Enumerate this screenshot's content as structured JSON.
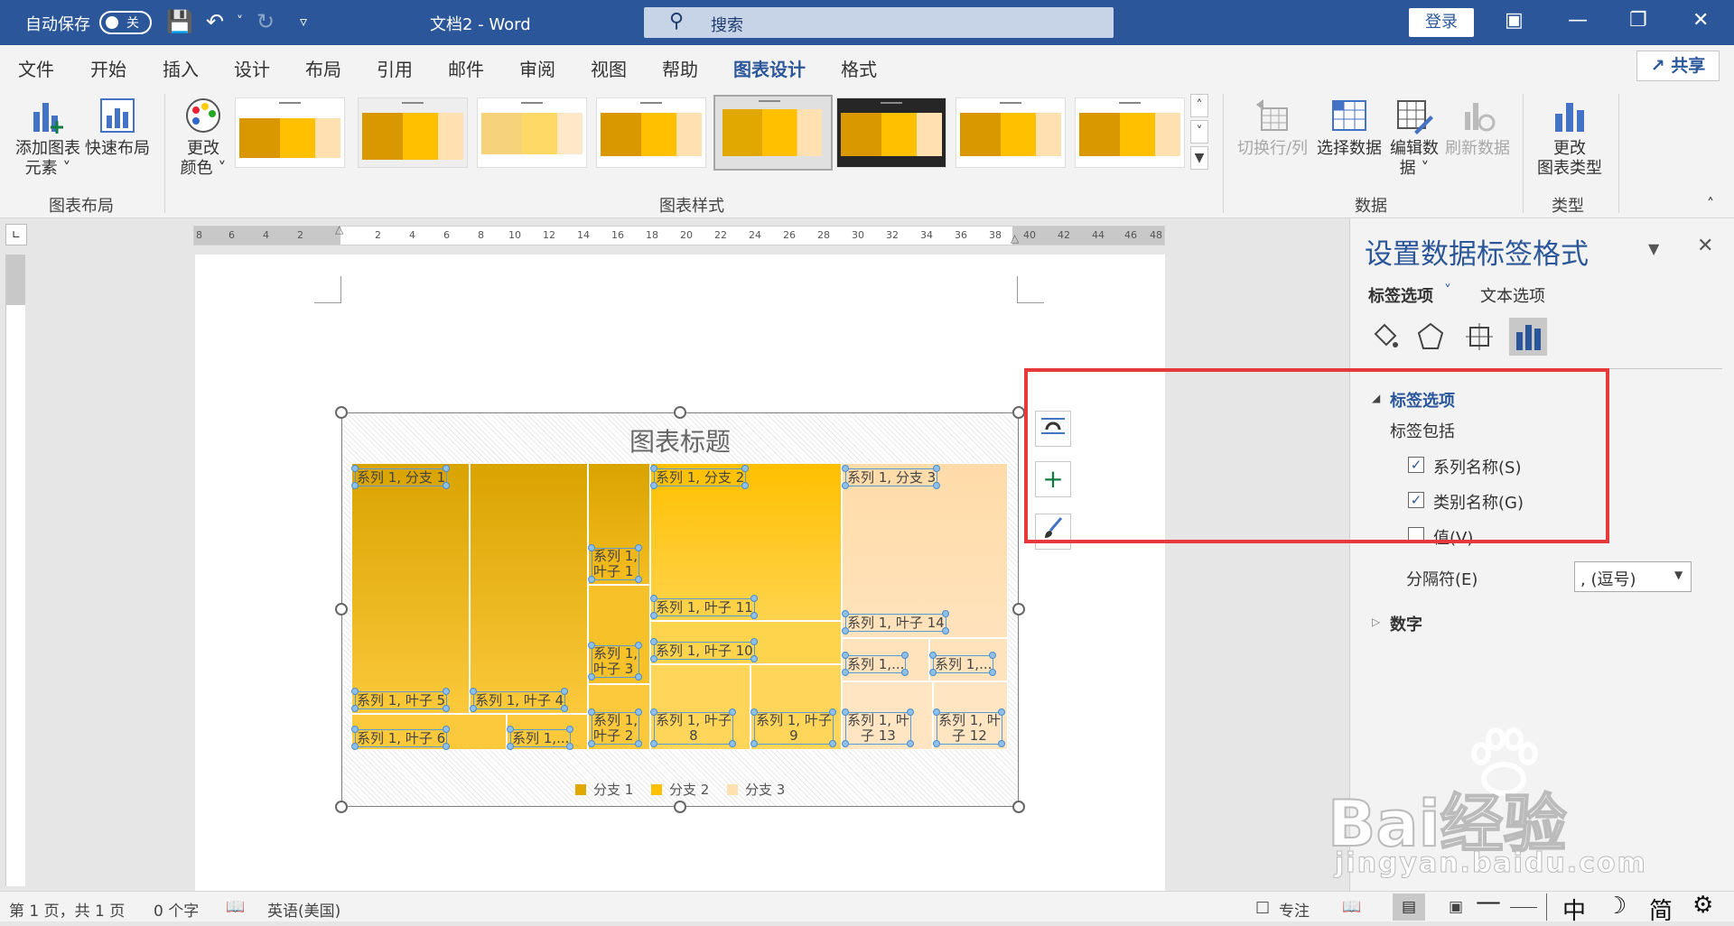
{
  "titlebar": {
    "autosave_label": "自动保存",
    "autosave_state": "关",
    "document_title": "文档2  -  Word",
    "search_placeholder": "搜索",
    "login_label": "登录"
  },
  "menu_tabs": [
    "文件",
    "开始",
    "插入",
    "设计",
    "布局",
    "引用",
    "邮件",
    "审阅",
    "视图",
    "帮助",
    "图表设计",
    "格式"
  ],
  "active_tab": "图表设计",
  "share_label": "共享",
  "ribbon": {
    "add_element": [
      "添加图表",
      "元素 ˅"
    ],
    "quick_layout": "快速布局",
    "change_colors": [
      "更改",
      "颜色 ˅"
    ],
    "group_layout": "图表布局",
    "group_styles": "图表样式",
    "switch_row_col": "切换行/列",
    "select_data": "选择数据",
    "edit_data": [
      "编辑数",
      "据 ˅"
    ],
    "refresh_data": "刷新数据",
    "group_data": "数据",
    "change_type": [
      "更改",
      "图表类型"
    ],
    "group_type": "类型"
  },
  "ruler_ticks": [
    "8",
    "6",
    "4",
    "2",
    "",
    "2",
    "4",
    "6",
    "8",
    "10",
    "12",
    "14",
    "16",
    "18",
    "20",
    "22",
    "24",
    "26",
    "28",
    "30",
    "32",
    "34",
    "36",
    "38",
    "40",
    "42",
    "44",
    "46",
    "48"
  ],
  "chart": {
    "title": "图表标题",
    "labels": {
      "branch1": "系列 1, 分支 1",
      "branch2": "系列 1, 分支 2",
      "branch3": "系列 1, 分支 3",
      "leaf5": "系列 1, 叶子 5",
      "leaf4": "系列 1, 叶子 4",
      "leaf6": "系列 1, 叶子 6",
      "leafx": "系列 1,...",
      "leaf1a": "系列 1,",
      "leaf1b": "叶子 1",
      "leaf3a": "系列 1,",
      "leaf3b": "叶子 3",
      "leaf2a": "系列 1,",
      "leaf2b": "叶子 2",
      "leaf11": "系列 1, 叶子 11",
      "leaf10": "系列 1, 叶子 10",
      "leaf8a": "系列 1, 叶子",
      "leaf8b": "8",
      "leaf9a": "系列 1, 叶子",
      "leaf9b": "9",
      "leaf14": "系列 1, 叶子 14",
      "leafy": "系列 1,...",
      "leafz": "系列 1,...",
      "leaf13a": "系列 1, 叶",
      "leaf13b": "子 13",
      "leaf12a": "系列 1, 叶",
      "leaf12b": "子 12"
    },
    "legend": [
      "分支 1",
      "分支 2",
      "分支 3"
    ],
    "colors": {
      "branch1": "#e0a800",
      "branch2": "#ffc000",
      "branch3": "#ffe0b0"
    }
  },
  "pane": {
    "title": "设置数据标签格式",
    "tab_label_options": "标签选项",
    "tab_text_options": "文本选项",
    "section_label_options": "标签选项",
    "label_contains": "标签包括",
    "cb_series_name": "系列名称(S)",
    "cb_category_name": "类别名称(G)",
    "cb_value": "值(V)",
    "separator_label": "分隔符(E)",
    "separator_value": ", (逗号)",
    "section_number": "数字"
  },
  "status": {
    "page": "第 1 页，共 1 页",
    "words": "0 个字",
    "language": "英语(美国)",
    "focus": "专注",
    "ime": [
      "中",
      "简"
    ]
  },
  "watermark": {
    "brand": "Bai经验",
    "url": "jingyan.baidu.com"
  }
}
